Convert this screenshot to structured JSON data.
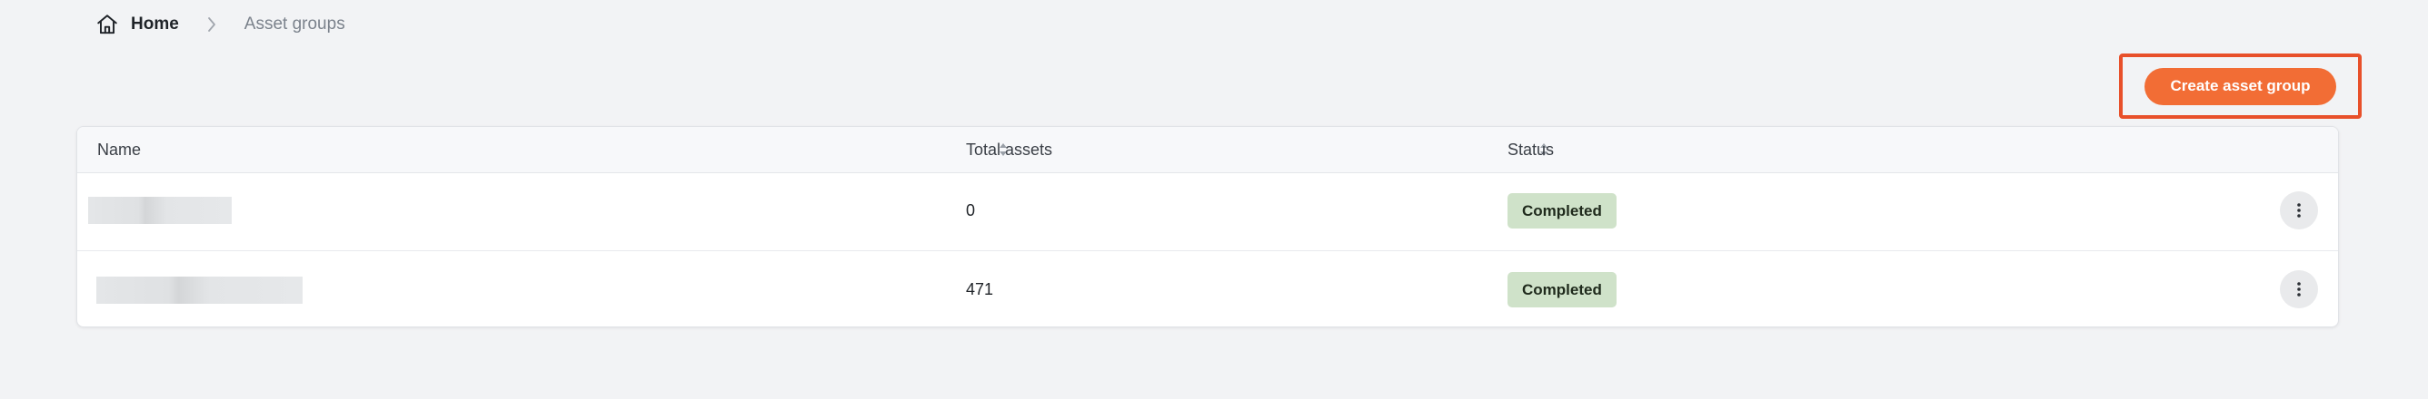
{
  "breadcrumb": {
    "home_label": "Home",
    "current_label": "Asset groups"
  },
  "actions": {
    "create_label": "Create asset group",
    "highlight_color": "#e8502a",
    "button_color": "#f26d35"
  },
  "table": {
    "columns": [
      {
        "label": "Name",
        "sortable": true
      },
      {
        "label": "Total assets",
        "sortable": true
      },
      {
        "label": "Status",
        "sortable": false
      }
    ],
    "rows": [
      {
        "name": "",
        "total_assets": "0",
        "status": "Completed"
      },
      {
        "name": "",
        "total_assets": "471",
        "status": "Completed"
      }
    ],
    "status_color": "#cfe2c9"
  }
}
